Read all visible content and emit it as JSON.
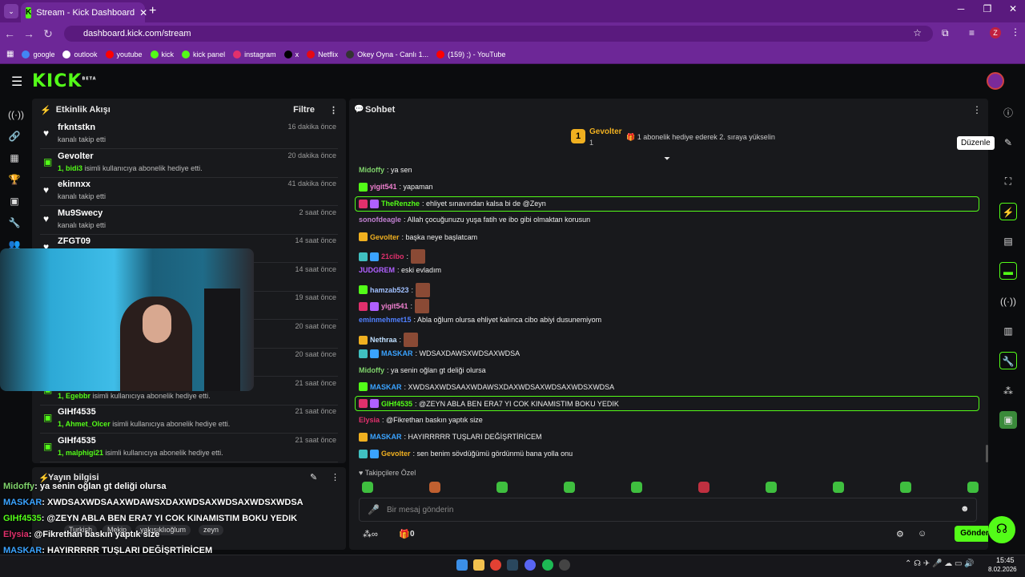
{
  "browser": {
    "tab_title": "Stream - Kick Dashboard",
    "url": "dashboard.kick.com/stream",
    "profile": "Z",
    "bookmarks": [
      {
        "label": "google",
        "color": "#4285f4"
      },
      {
        "label": "outlook",
        "color": "#ffffff"
      },
      {
        "label": "youtube",
        "color": "#ff0000"
      },
      {
        "label": "kick",
        "color": "#53fc18"
      },
      {
        "label": "kick panel",
        "color": "#53fc18"
      },
      {
        "label": "instagram",
        "color": "#e1306c"
      },
      {
        "label": "x",
        "color": "#000000"
      },
      {
        "label": "Netflix",
        "color": "#e50914"
      },
      {
        "label": "Okey Oyna - Canlı 1...",
        "color": "#333333"
      },
      {
        "label": "(159) ;) - YouTube",
        "color": "#ff0000"
      }
    ]
  },
  "kick": {
    "logo": "KICK",
    "beta": "BETA"
  },
  "activity": {
    "title": "Etkinlik Akışı",
    "filter": "Filtre",
    "items": [
      {
        "name": "frkntstkn",
        "desc": "kanalı takip etti",
        "time": "16 dakika önce",
        "icon": "heart-icon",
        "highlight": ""
      },
      {
        "name": "Gevolter",
        "highlight": "1, bidi3",
        "desc": "isimli kullanıcıya abonelik hediye etti.",
        "time": "20 dakika önce",
        "icon": "gift-icon"
      },
      {
        "name": "ekinnxx",
        "desc": "kanalı takip etti",
        "time": "41 dakika önce",
        "icon": "heart-icon",
        "highlight": ""
      },
      {
        "name": "Mu9Swecy",
        "desc": "kanalı takip etti",
        "time": "2 saat önce",
        "icon": "heart-icon",
        "highlight": ""
      },
      {
        "name": "ZFGT09",
        "desc": "",
        "time": "14 saat önce",
        "icon": "heart-icon",
        "highlight": ""
      },
      {
        "name": "",
        "desc": "",
        "time": "14 saat önce",
        "icon": "heart-icon",
        "highlight": ""
      },
      {
        "name": "",
        "desc": "",
        "time": "19 saat önce",
        "icon": "heart-icon",
        "highlight": ""
      },
      {
        "name": "",
        "desc": "",
        "time": "20 saat önce",
        "icon": "heart-icon",
        "highlight": ""
      },
      {
        "name": "",
        "desc": "",
        "time": "20 saat önce",
        "icon": "heart-icon",
        "highlight": ""
      },
      {
        "name": "GIHf4535",
        "highlight": "1, Egebbr",
        "desc": "isimli kullanıcıya abonelik hediye etti.",
        "time": "21 saat önce",
        "icon": "gift-icon"
      },
      {
        "name": "GIHf4535",
        "highlight": "1, Ahmet_Olcer",
        "desc": "isimli kullanıcıya abonelik hediye etti.",
        "time": "21 saat önce",
        "icon": "gift-icon"
      },
      {
        "name": "GIHf4535",
        "highlight": "1, malphigi21",
        "desc": "isimli kullanıcıya abonelik hediye etti.",
        "time": "21 saat önce",
        "icon": "gift-icon"
      }
    ]
  },
  "stream_info": {
    "title": "Yayın bilgisi",
    "tags": [
      "Turkish",
      "Mekip",
      "yakışıklıoğlum",
      "zeyn"
    ]
  },
  "overlay_chat": [
    {
      "user": "Midoffy",
      "text": ": ya senin oğlan gt deliği olursa",
      "color": "#7fd36b"
    },
    {
      "user": "MASKAR",
      "text": ": XWDSAXWDSAAXWDAWSXDAXWDSAXWDSAXWDSXWDSA",
      "color": "#3aa3ff"
    },
    {
      "user": "GIHf4535",
      "text": ": @ZEYN ABLA BEN ERA7 YI COK KINAMISTIM BOKU YEDIK",
      "color": "#53fc18"
    },
    {
      "user": "Elysia",
      "text": ": @Fikrethan baskın yaptık size",
      "color": "#e0306c"
    },
    {
      "user": "MASKAR",
      "text": ": HAYIRRRRR TUŞLARI DEĞİŞRTİRİCEM",
      "color": "#3aa3ff"
    },
    {
      "user": "Gevolter",
      "text": ": sen benim sövdüğümü gördünmü bana yolla onu",
      "color": "#f0b020"
    }
  ],
  "chat": {
    "title": "Sohbet",
    "top_gifter": {
      "name": "Gevolter",
      "count": "1",
      "rank": "1"
    },
    "gift_prompt": "1 abonelik hediye ederek 2. sıraya yükselin",
    "messages": [
      {
        "user": "Midoffy",
        "text": ": ya sen",
        "color": "#7fd36b",
        "highlight": false
      },
      {
        "user": "yigit541",
        "text": ": yapaman",
        "color": "#f080d0",
        "highlight": false
      },
      {
        "user": "TheRenzhe",
        "text": ": ehliyet sınavından kalsa bi de @Zeyn",
        "color": "#53fc18",
        "highlight": true
      },
      {
        "user": "sonofdeagle",
        "text": ": Allah çocuğunuzu yuşa fatih ve ibo gibi olmaktan korusun",
        "color": "#c080d0",
        "highlight": false
      },
      {
        "user": "Gevolter",
        "text": ": başka neye başlatcam",
        "color": "#f0b020",
        "highlight": false
      },
      {
        "user": "21cibo",
        "text": ":",
        "color": "#e0306c",
        "highlight": false
      },
      {
        "user": "JUDGREM",
        "text": ": eski evladım",
        "color": "#b060ff",
        "highlight": false
      },
      {
        "user": "hamzab523",
        "text": ":",
        "color": "#a0c0ff",
        "highlight": false
      },
      {
        "user": "yigit541",
        "text": ":",
        "color": "#f080d0",
        "highlight": false
      },
      {
        "user": "eminmehmet15",
        "text": ": Abla oğlum olursa ehliyet kalınca cibo abiyi dusunemiyom",
        "color": "#5080ff",
        "highlight": false
      },
      {
        "user": "Nethraa",
        "text": ":",
        "color": "#c0e0ff",
        "highlight": false
      },
      {
        "user": "MASKAR",
        "text": ": WDSAXDAWSXWDSAXWDSA",
        "color": "#3aa3ff",
        "highlight": false
      },
      {
        "user": "Midoffy",
        "text": ": ya senin oğlan gt deliği olursa",
        "color": "#7fd36b",
        "highlight": false
      },
      {
        "user": "MASKAR",
        "text": ": XWDSAXWDSAAXWDAWSXDAXWDSAXWDSAXWDSXWDSA",
        "color": "#3aa3ff",
        "highlight": false
      },
      {
        "user": "GIHf4535",
        "text": ": @ZEYN ABLA BEN ERA7 YI COK KINAMISTIM BOKU YEDIK",
        "color": "#53fc18",
        "highlight": true
      },
      {
        "user": "Elysia",
        "text": ": @Fikrethan baskın yaptık size",
        "color": "#e0306c",
        "highlight": false
      },
      {
        "user": "MASKAR",
        "text": ": HAYIRRRRR TUŞLARI DEĞİŞRTİRİCEM",
        "color": "#3aa3ff",
        "highlight": false
      },
      {
        "user": "Gevolter",
        "text": ": sen benim sövdüğümü gördünmü bana yolla onu",
        "color": "#f0b020",
        "highlight": false
      }
    ],
    "followers_only": "Takipçilere Özel",
    "placeholder": "Bir mesaj gönderin",
    "send": "Gönder",
    "bottom_count": "0"
  },
  "right_rail": {
    "tooltip": "Düzenle"
  },
  "clock": {
    "time": "15:45",
    "date": "8.02.2026"
  }
}
